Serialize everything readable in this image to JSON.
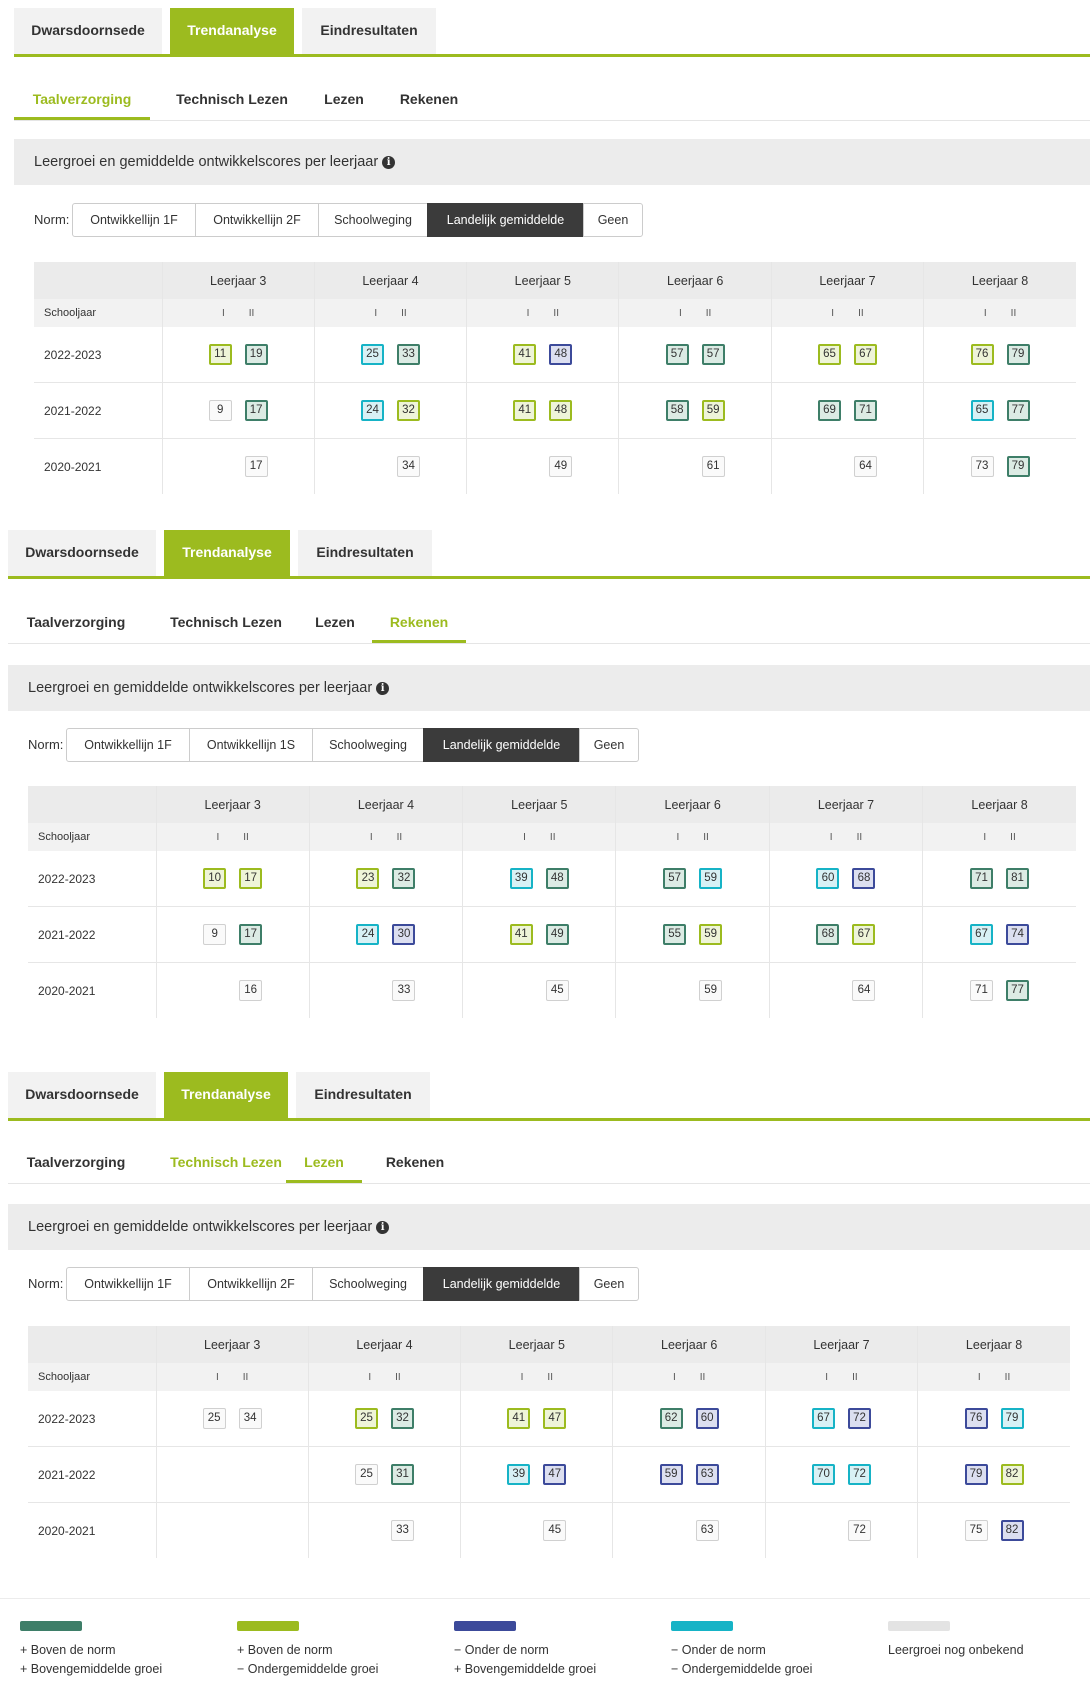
{
  "main_tabs": [
    "Dwarsdoornsede",
    "Trendanalyse",
    "Eindresultaten"
  ],
  "panels": [
    {
      "subtabs": [
        "Taalverzorging",
        "Technisch Lezen",
        "Lezen",
        "Rekenen"
      ],
      "heading": "Leergroei en gemiddelde ontwikkelscores per leerjaar",
      "norm_label": "Norm:",
      "norm_options": [
        "Ontwikkellijn 1F",
        "Ontwikkellijn 2F",
        "Schoolweging",
        "Landelijk gemiddelde",
        "Geen"
      ],
      "table": {
        "columns": [
          "Leerjaar 3",
          "Leerjaar 4",
          "Leerjaar 5",
          "Leerjaar 6",
          "Leerjaar 7",
          "Leerjaar 8"
        ],
        "subheader_label": "Schooljaar",
        "semesters": [
          "I",
          "II"
        ],
        "rows": [
          {
            "year": "2022-2023",
            "cells": [
              [
                {
                  "v": "11",
                  "c": "lime"
                },
                {
                  "v": "19",
                  "c": "darkgreen"
                }
              ],
              [
                {
                  "v": "25",
                  "c": "teal"
                },
                {
                  "v": "33",
                  "c": "darkgreen"
                }
              ],
              [
                {
                  "v": "41",
                  "c": "lime"
                },
                {
                  "v": "48",
                  "c": "navy"
                }
              ],
              [
                {
                  "v": "57",
                  "c": "darkgreen"
                },
                {
                  "v": "57",
                  "c": "darkgreen"
                }
              ],
              [
                {
                  "v": "65",
                  "c": "lime"
                },
                {
                  "v": "67",
                  "c": "lime"
                }
              ],
              [
                {
                  "v": "76",
                  "c": "lime"
                },
                {
                  "v": "79",
                  "c": "darkgreen"
                }
              ]
            ]
          },
          {
            "year": "2021-2022",
            "cells": [
              [
                {
                  "v": "9",
                  "c": "grey"
                },
                {
                  "v": "17",
                  "c": "darkgreen"
                }
              ],
              [
                {
                  "v": "24",
                  "c": "teal"
                },
                {
                  "v": "32",
                  "c": "lime"
                }
              ],
              [
                {
                  "v": "41",
                  "c": "lime"
                },
                {
                  "v": "48",
                  "c": "lime"
                }
              ],
              [
                {
                  "v": "58",
                  "c": "darkgreen"
                },
                {
                  "v": "59",
                  "c": "lime"
                }
              ],
              [
                {
                  "v": "69",
                  "c": "darkgreen"
                },
                {
                  "v": "71",
                  "c": "darkgreen"
                }
              ],
              [
                {
                  "v": "65",
                  "c": "teal"
                },
                {
                  "v": "77",
                  "c": "darkgreen"
                }
              ]
            ]
          },
          {
            "year": "2020-2021",
            "cells": [
              [
                null,
                {
                  "v": "17",
                  "c": "grey"
                }
              ],
              [
                null,
                {
                  "v": "34",
                  "c": "grey"
                }
              ],
              [
                null,
                {
                  "v": "49",
                  "c": "grey"
                }
              ],
              [
                null,
                {
                  "v": "61",
                  "c": "grey"
                }
              ],
              [
                null,
                {
                  "v": "64",
                  "c": "grey"
                }
              ],
              [
                {
                  "v": "73",
                  "c": "grey"
                },
                {
                  "v": "79",
                  "c": "darkgreen"
                }
              ]
            ]
          }
        ]
      }
    },
    {
      "subtabs": [
        "Taalverzorging",
        "Technisch Lezen",
        "Lezen",
        "Rekenen"
      ],
      "heading": "Leergroei en gemiddelde ontwikkelscores per leerjaar",
      "norm_label": "Norm:",
      "norm_options": [
        "Ontwikkellijn 1F",
        "Ontwikkellijn 1S",
        "Schoolweging",
        "Landelijk gemiddelde",
        "Geen"
      ],
      "table": {
        "columns": [
          "Leerjaar 3",
          "Leerjaar 4",
          "Leerjaar 5",
          "Leerjaar 6",
          "Leerjaar 7",
          "Leerjaar 8"
        ],
        "subheader_label": "Schooljaar",
        "semesters": [
          "I",
          "II"
        ],
        "rows": [
          {
            "year": "2022-2023",
            "cells": [
              [
                {
                  "v": "10",
                  "c": "lime"
                },
                {
                  "v": "17",
                  "c": "lime"
                }
              ],
              [
                {
                  "v": "23",
                  "c": "lime"
                },
                {
                  "v": "32",
                  "c": "darkgreen"
                }
              ],
              [
                {
                  "v": "39",
                  "c": "teal"
                },
                {
                  "v": "48",
                  "c": "darkgreen"
                }
              ],
              [
                {
                  "v": "57",
                  "c": "darkgreen"
                },
                {
                  "v": "59",
                  "c": "teal"
                }
              ],
              [
                {
                  "v": "60",
                  "c": "teal"
                },
                {
                  "v": "68",
                  "c": "navy"
                }
              ],
              [
                {
                  "v": "71",
                  "c": "darkgreen"
                },
                {
                  "v": "81",
                  "c": "darkgreen"
                }
              ]
            ]
          },
          {
            "year": "2021-2022",
            "cells": [
              [
                {
                  "v": "9",
                  "c": "grey"
                },
                {
                  "v": "17",
                  "c": "darkgreen"
                }
              ],
              [
                {
                  "v": "24",
                  "c": "teal"
                },
                {
                  "v": "30",
                  "c": "navy"
                }
              ],
              [
                {
                  "v": "41",
                  "c": "lime"
                },
                {
                  "v": "49",
                  "c": "darkgreen"
                }
              ],
              [
                {
                  "v": "55",
                  "c": "darkgreen"
                },
                {
                  "v": "59",
                  "c": "lime"
                }
              ],
              [
                {
                  "v": "68",
                  "c": "darkgreen"
                },
                {
                  "v": "67",
                  "c": "lime"
                }
              ],
              [
                {
                  "v": "67",
                  "c": "teal"
                },
                {
                  "v": "74",
                  "c": "navy"
                }
              ]
            ]
          },
          {
            "year": "2020-2021",
            "cells": [
              [
                null,
                {
                  "v": "16",
                  "c": "grey"
                }
              ],
              [
                null,
                {
                  "v": "33",
                  "c": "grey"
                }
              ],
              [
                null,
                {
                  "v": "45",
                  "c": "grey"
                }
              ],
              [
                null,
                {
                  "v": "59",
                  "c": "grey"
                }
              ],
              [
                null,
                {
                  "v": "64",
                  "c": "grey"
                }
              ],
              [
                {
                  "v": "71",
                  "c": "grey"
                },
                {
                  "v": "77",
                  "c": "darkgreen"
                }
              ]
            ]
          }
        ]
      }
    },
    {
      "subtabs": [
        "Taalverzorging",
        "Technisch Lezen",
        "Lezen",
        "Rekenen"
      ],
      "heading": "Leergroei en gemiddelde ontwikkelscores per leerjaar",
      "norm_label": "Norm:",
      "norm_options": [
        "Ontwikkellijn 1F",
        "Ontwikkellijn 2F",
        "Schoolweging",
        "Landelijk gemiddelde",
        "Geen"
      ],
      "table": {
        "columns": [
          "Leerjaar 3",
          "Leerjaar 4",
          "Leerjaar 5",
          "Leerjaar 6",
          "Leerjaar 7",
          "Leerjaar 8"
        ],
        "subheader_label": "Schooljaar",
        "semesters": [
          "I",
          "II"
        ],
        "rows": [
          {
            "year": "2022-2023",
            "cells": [
              [
                {
                  "v": "25",
                  "c": "grey"
                },
                {
                  "v": "34",
                  "c": "grey"
                }
              ],
              [
                {
                  "v": "25",
                  "c": "lime"
                },
                {
                  "v": "32",
                  "c": "darkgreen"
                }
              ],
              [
                {
                  "v": "41",
                  "c": "lime"
                },
                {
                  "v": "47",
                  "c": "lime"
                }
              ],
              [
                {
                  "v": "62",
                  "c": "darkgreen"
                },
                {
                  "v": "60",
                  "c": "navy"
                }
              ],
              [
                {
                  "v": "67",
                  "c": "teal"
                },
                {
                  "v": "72",
                  "c": "navy"
                }
              ],
              [
                {
                  "v": "76",
                  "c": "navy"
                },
                {
                  "v": "79",
                  "c": "teal"
                }
              ]
            ]
          },
          {
            "year": "2021-2022",
            "cells": [
              [
                null,
                null
              ],
              [
                {
                  "v": "25",
                  "c": "grey"
                },
                {
                  "v": "31",
                  "c": "darkgreen"
                }
              ],
              [
                {
                  "v": "39",
                  "c": "teal"
                },
                {
                  "v": "47",
                  "c": "navy"
                }
              ],
              [
                {
                  "v": "59",
                  "c": "navy"
                },
                {
                  "v": "63",
                  "c": "navy"
                }
              ],
              [
                {
                  "v": "70",
                  "c": "teal"
                },
                {
                  "v": "72",
                  "c": "teal"
                }
              ],
              [
                {
                  "v": "79",
                  "c": "navy"
                },
                {
                  "v": "82",
                  "c": "lime"
                }
              ]
            ]
          },
          {
            "year": "2020-2021",
            "cells": [
              [
                null,
                null
              ],
              [
                null,
                {
                  "v": "33",
                  "c": "grey"
                }
              ],
              [
                null,
                {
                  "v": "45",
                  "c": "grey"
                }
              ],
              [
                null,
                {
                  "v": "63",
                  "c": "grey"
                }
              ],
              [
                null,
                {
                  "v": "72",
                  "c": "grey"
                }
              ],
              [
                {
                  "v": "75",
                  "c": "grey"
                },
                {
                  "v": "82",
                  "c": "navy"
                }
              ]
            ]
          }
        ]
      }
    }
  ],
  "legend": [
    {
      "color": "#3e7e68",
      "line1": "+ Boven de norm",
      "line2": "+ Bovengemiddelde groei"
    },
    {
      "color": "#9cbb1f",
      "line1": "+ Boven de norm",
      "line2": "− Ondergemiddelde groei"
    },
    {
      "color": "#3c4a9a",
      "line1": "− Onder de norm",
      "line2": "+ Bovengemiddelde groei"
    },
    {
      "color": "#16b3c6",
      "line1": "− Onder de norm",
      "line2": "− Ondergemiddelde groei"
    },
    {
      "color": "#e3e3e3",
      "line1": "Leergroei nog onbekend",
      "line2": ""
    }
  ],
  "colors": {
    "accent": "#9cbb1f",
    "dark": "#3b3b3b"
  }
}
